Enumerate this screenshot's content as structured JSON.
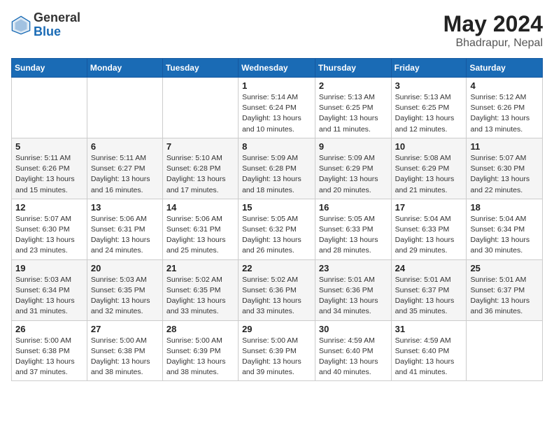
{
  "header": {
    "logo_general": "General",
    "logo_blue": "Blue",
    "month_year": "May 2024",
    "location": "Bhadrapur, Nepal"
  },
  "weekdays": [
    "Sunday",
    "Monday",
    "Tuesday",
    "Wednesday",
    "Thursday",
    "Friday",
    "Saturday"
  ],
  "weeks": [
    [
      {
        "day": "",
        "info": ""
      },
      {
        "day": "",
        "info": ""
      },
      {
        "day": "",
        "info": ""
      },
      {
        "day": "1",
        "info": "Sunrise: 5:14 AM\nSunset: 6:24 PM\nDaylight: 13 hours\nand 10 minutes."
      },
      {
        "day": "2",
        "info": "Sunrise: 5:13 AM\nSunset: 6:25 PM\nDaylight: 13 hours\nand 11 minutes."
      },
      {
        "day": "3",
        "info": "Sunrise: 5:13 AM\nSunset: 6:25 PM\nDaylight: 13 hours\nand 12 minutes."
      },
      {
        "day": "4",
        "info": "Sunrise: 5:12 AM\nSunset: 6:26 PM\nDaylight: 13 hours\nand 13 minutes."
      }
    ],
    [
      {
        "day": "5",
        "info": "Sunrise: 5:11 AM\nSunset: 6:26 PM\nDaylight: 13 hours\nand 15 minutes."
      },
      {
        "day": "6",
        "info": "Sunrise: 5:11 AM\nSunset: 6:27 PM\nDaylight: 13 hours\nand 16 minutes."
      },
      {
        "day": "7",
        "info": "Sunrise: 5:10 AM\nSunset: 6:28 PM\nDaylight: 13 hours\nand 17 minutes."
      },
      {
        "day": "8",
        "info": "Sunrise: 5:09 AM\nSunset: 6:28 PM\nDaylight: 13 hours\nand 18 minutes."
      },
      {
        "day": "9",
        "info": "Sunrise: 5:09 AM\nSunset: 6:29 PM\nDaylight: 13 hours\nand 20 minutes."
      },
      {
        "day": "10",
        "info": "Sunrise: 5:08 AM\nSunset: 6:29 PM\nDaylight: 13 hours\nand 21 minutes."
      },
      {
        "day": "11",
        "info": "Sunrise: 5:07 AM\nSunset: 6:30 PM\nDaylight: 13 hours\nand 22 minutes."
      }
    ],
    [
      {
        "day": "12",
        "info": "Sunrise: 5:07 AM\nSunset: 6:30 PM\nDaylight: 13 hours\nand 23 minutes."
      },
      {
        "day": "13",
        "info": "Sunrise: 5:06 AM\nSunset: 6:31 PM\nDaylight: 13 hours\nand 24 minutes."
      },
      {
        "day": "14",
        "info": "Sunrise: 5:06 AM\nSunset: 6:31 PM\nDaylight: 13 hours\nand 25 minutes."
      },
      {
        "day": "15",
        "info": "Sunrise: 5:05 AM\nSunset: 6:32 PM\nDaylight: 13 hours\nand 26 minutes."
      },
      {
        "day": "16",
        "info": "Sunrise: 5:05 AM\nSunset: 6:33 PM\nDaylight: 13 hours\nand 28 minutes."
      },
      {
        "day": "17",
        "info": "Sunrise: 5:04 AM\nSunset: 6:33 PM\nDaylight: 13 hours\nand 29 minutes."
      },
      {
        "day": "18",
        "info": "Sunrise: 5:04 AM\nSunset: 6:34 PM\nDaylight: 13 hours\nand 30 minutes."
      }
    ],
    [
      {
        "day": "19",
        "info": "Sunrise: 5:03 AM\nSunset: 6:34 PM\nDaylight: 13 hours\nand 31 minutes."
      },
      {
        "day": "20",
        "info": "Sunrise: 5:03 AM\nSunset: 6:35 PM\nDaylight: 13 hours\nand 32 minutes."
      },
      {
        "day": "21",
        "info": "Sunrise: 5:02 AM\nSunset: 6:35 PM\nDaylight: 13 hours\nand 33 minutes."
      },
      {
        "day": "22",
        "info": "Sunrise: 5:02 AM\nSunset: 6:36 PM\nDaylight: 13 hours\nand 33 minutes."
      },
      {
        "day": "23",
        "info": "Sunrise: 5:01 AM\nSunset: 6:36 PM\nDaylight: 13 hours\nand 34 minutes."
      },
      {
        "day": "24",
        "info": "Sunrise: 5:01 AM\nSunset: 6:37 PM\nDaylight: 13 hours\nand 35 minutes."
      },
      {
        "day": "25",
        "info": "Sunrise: 5:01 AM\nSunset: 6:37 PM\nDaylight: 13 hours\nand 36 minutes."
      }
    ],
    [
      {
        "day": "26",
        "info": "Sunrise: 5:00 AM\nSunset: 6:38 PM\nDaylight: 13 hours\nand 37 minutes."
      },
      {
        "day": "27",
        "info": "Sunrise: 5:00 AM\nSunset: 6:38 PM\nDaylight: 13 hours\nand 38 minutes."
      },
      {
        "day": "28",
        "info": "Sunrise: 5:00 AM\nSunset: 6:39 PM\nDaylight: 13 hours\nand 38 minutes."
      },
      {
        "day": "29",
        "info": "Sunrise: 5:00 AM\nSunset: 6:39 PM\nDaylight: 13 hours\nand 39 minutes."
      },
      {
        "day": "30",
        "info": "Sunrise: 4:59 AM\nSunset: 6:40 PM\nDaylight: 13 hours\nand 40 minutes."
      },
      {
        "day": "31",
        "info": "Sunrise: 4:59 AM\nSunset: 6:40 PM\nDaylight: 13 hours\nand 41 minutes."
      },
      {
        "day": "",
        "info": ""
      }
    ]
  ]
}
